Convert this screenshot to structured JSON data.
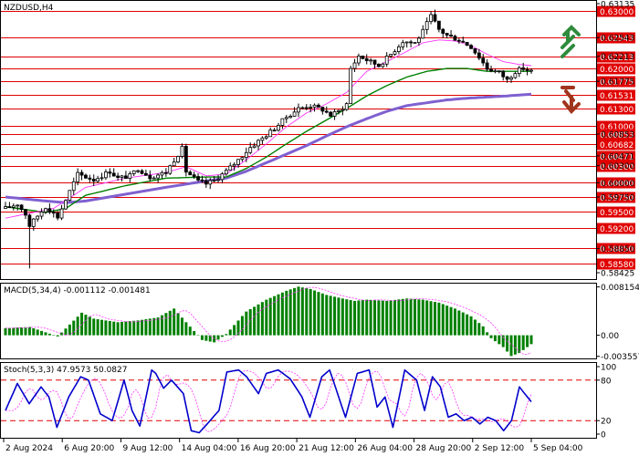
{
  "chart_data": [
    {
      "type": "candlestick",
      "title": "NZDUSD,H4",
      "ylim": [
        0.58425,
        0.63135
      ],
      "y_ticks": [
        "0.63135",
        "0.62543",
        "0.62213",
        "0.61775",
        "0.60853",
        "0.60471",
        "0.60300",
        "0.60000",
        "0.59750",
        "0.58850",
        "0.58425"
      ],
      "level_lines": [
        "0.63000",
        "0.62543",
        "0.62213",
        "0.62000",
        "0.61775",
        "0.61531",
        "0.61300",
        "0.61000",
        "0.60853",
        "0.60682",
        "0.60471",
        "0.60300",
        "0.60000",
        "0.59750",
        "0.59500",
        "0.59200",
        "0.58850",
        "0.58580"
      ],
      "x_labels": [
        "2 Aug 2024",
        "6 Aug 20:00",
        "9 Aug 12:00",
        "14 Aug 04:00",
        "16 Aug 20:00",
        "21 Aug 12:00",
        "26 Aug 04:00",
        "28 Aug 20:00",
        "2 Sep 12:00",
        "5 Sep 04:00"
      ],
      "colors": {
        "level": "#e00000",
        "ma_fast": "#ff33ff",
        "ma_mid": "#008000",
        "ma_slow": "#8060d0",
        "arrow_up": "#2e8b3c",
        "arrow_down": "#a0341c"
      },
      "close_path": [
        [
          0,
          0.5955
        ],
        [
          3,
          0.5963
        ],
        [
          5,
          0.5945
        ],
        [
          6,
          0.5925
        ],
        [
          8,
          0.5942
        ],
        [
          10,
          0.5958
        ],
        [
          13,
          0.594
        ],
        [
          16,
          0.5985
        ],
        [
          18,
          0.6015
        ],
        [
          22,
          0.6005
        ],
        [
          26,
          0.602
        ],
        [
          28,
          0.6008
        ],
        [
          31,
          0.6012
        ],
        [
          33,
          0.6025
        ],
        [
          36,
          0.601
        ],
        [
          40,
          0.6018
        ],
        [
          42,
          0.604
        ],
        [
          44,
          0.606
        ],
        [
          45,
          0.602
        ],
        [
          48,
          0.6002
        ],
        [
          50,
          0.5998
        ],
        [
          52,
          0.6004
        ],
        [
          55,
          0.602
        ],
        [
          58,
          0.604
        ],
        [
          61,
          0.6062
        ],
        [
          64,
          0.6078
        ],
        [
          67,
          0.6095
        ],
        [
          70,
          0.6115
        ],
        [
          73,
          0.613
        ],
        [
          76,
          0.6135
        ],
        [
          79,
          0.6128
        ],
        [
          81,
          0.6118
        ],
        [
          83,
          0.6125
        ],
        [
          85,
          0.6138
        ],
        [
          86,
          0.62
        ],
        [
          88,
          0.6222
        ],
        [
          90,
          0.6215
        ],
        [
          93,
          0.6205
        ],
        [
          96,
          0.6225
        ],
        [
          99,
          0.6248
        ],
        [
          102,
          0.6245
        ],
        [
          104,
          0.6265
        ],
        [
          106,
          0.6292
        ],
        [
          108,
          0.6268
        ],
        [
          110,
          0.6258
        ],
        [
          113,
          0.625
        ],
        [
          116,
          0.6238
        ],
        [
          118,
          0.622
        ],
        [
          120,
          0.62
        ],
        [
          123,
          0.6193
        ],
        [
          125,
          0.618
        ],
        [
          127,
          0.6195
        ],
        [
          129,
          0.62
        ],
        [
          131,
          0.6195
        ]
      ],
      "ma_fast_path": [
        [
          0,
          0.5938
        ],
        [
          12,
          0.5955
        ],
        [
          20,
          0.5992
        ],
        [
          30,
          0.6008
        ],
        [
          40,
          0.6018
        ],
        [
          45,
          0.6028
        ],
        [
          50,
          0.6012
        ],
        [
          55,
          0.6015
        ],
        [
          60,
          0.604
        ],
        [
          65,
          0.6068
        ],
        [
          70,
          0.6098
        ],
        [
          75,
          0.6122
        ],
        [
          80,
          0.6138
        ],
        [
          85,
          0.6158
        ],
        [
          90,
          0.6195
        ],
        [
          95,
          0.6212
        ],
        [
          100,
          0.623
        ],
        [
          104,
          0.6245
        ],
        [
          108,
          0.625
        ],
        [
          112,
          0.6248
        ],
        [
          116,
          0.624
        ],
        [
          120,
          0.6225
        ],
        [
          124,
          0.6212
        ],
        [
          128,
          0.6207
        ],
        [
          131,
          0.6205
        ]
      ],
      "ma_mid_path": [
        [
          0,
          0.5958
        ],
        [
          10,
          0.5948
        ],
        [
          15,
          0.5955
        ],
        [
          20,
          0.5978
        ],
        [
          30,
          0.5995
        ],
        [
          40,
          0.6008
        ],
        [
          50,
          0.601
        ],
        [
          55,
          0.601
        ],
        [
          60,
          0.6025
        ],
        [
          65,
          0.6045
        ],
        [
          70,
          0.6068
        ],
        [
          75,
          0.609
        ],
        [
          80,
          0.611
        ],
        [
          85,
          0.613
        ],
        [
          90,
          0.6152
        ],
        [
          95,
          0.617
        ],
        [
          100,
          0.6185
        ],
        [
          105,
          0.6195
        ],
        [
          110,
          0.62
        ],
        [
          115,
          0.62
        ],
        [
          120,
          0.6195
        ],
        [
          125,
          0.6195
        ],
        [
          131,
          0.6195
        ]
      ],
      "ma_slow_path": [
        [
          0,
          0.5975
        ],
        [
          10,
          0.5968
        ],
        [
          15,
          0.5965
        ],
        [
          20,
          0.5968
        ],
        [
          30,
          0.598
        ],
        [
          40,
          0.5992
        ],
        [
          50,
          0.6003
        ],
        [
          55,
          0.6008
        ],
        [
          60,
          0.602
        ],
        [
          65,
          0.6035
        ],
        [
          70,
          0.605
        ],
        [
          75,
          0.6065
        ],
        [
          80,
          0.6082
        ],
        [
          85,
          0.6098
        ],
        [
          90,
          0.6112
        ],
        [
          95,
          0.6125
        ],
        [
          100,
          0.6135
        ],
        [
          105,
          0.614
        ],
        [
          110,
          0.6145
        ],
        [
          115,
          0.6148
        ],
        [
          120,
          0.615
        ],
        [
          125,
          0.6152
        ],
        [
          131,
          0.6155
        ]
      ],
      "n_bars": 132
    },
    {
      "type": "histogram",
      "title": "MACD(5,34,4) -0.001112 -0.001481",
      "ylim": [
        -0.0036,
        0.0084
      ],
      "y_ticks": [
        "0.008154",
        "0.00",
        "-0.003557"
      ],
      "colors": {
        "bars": "#008000",
        "signal": "#ff33ff"
      },
      "bar_profile": [
        [
          0,
          0.0012
        ],
        [
          6,
          0.0014
        ],
        [
          10,
          0.0005
        ],
        [
          13,
          -0.0002
        ],
        [
          16,
          0.0018
        ],
        [
          19,
          0.0038
        ],
        [
          22,
          0.0028
        ],
        [
          28,
          0.0022
        ],
        [
          33,
          0.0025
        ],
        [
          38,
          0.003
        ],
        [
          42,
          0.0045
        ],
        [
          45,
          0.0022
        ],
        [
          49,
          -0.0008
        ],
        [
          52,
          -0.0012
        ],
        [
          55,
          0.0002
        ],
        [
          60,
          0.004
        ],
        [
          65,
          0.006
        ],
        [
          70,
          0.0075
        ],
        [
          73,
          0.0082
        ],
        [
          76,
          0.0078
        ],
        [
          80,
          0.0068
        ],
        [
          84,
          0.0062
        ],
        [
          87,
          0.0058
        ],
        [
          90,
          0.006
        ],
        [
          95,
          0.0058
        ],
        [
          100,
          0.0062
        ],
        [
          104,
          0.006
        ],
        [
          108,
          0.0055
        ],
        [
          112,
          0.0045
        ],
        [
          116,
          0.0032
        ],
        [
          119,
          0.0015
        ],
        [
          121,
          -0.0005
        ],
        [
          124,
          -0.002
        ],
        [
          126,
          -0.0035
        ],
        [
          128,
          -0.003
        ],
        [
          131,
          -0.0015
        ]
      ],
      "signal_lag": 2
    },
    {
      "type": "line",
      "title": "Stoch(5,3,3) 47.9573 50.0827",
      "ylim": [
        0,
        100
      ],
      "y_ticks": [
        "100",
        "80",
        "20",
        "0"
      ],
      "levels": [
        80,
        20
      ],
      "colors": {
        "main": "#0000cc",
        "signal": "#ff33ff",
        "levels": "#e00000"
      },
      "main_path": [
        [
          0,
          35
        ],
        [
          3,
          75
        ],
        [
          6,
          45
        ],
        [
          9,
          70
        ],
        [
          11,
          55
        ],
        [
          13,
          10
        ],
        [
          16,
          55
        ],
        [
          19,
          85
        ],
        [
          21,
          80
        ],
        [
          24,
          30
        ],
        [
          27,
          20
        ],
        [
          30,
          80
        ],
        [
          32,
          35
        ],
        [
          34,
          12
        ],
        [
          37,
          95
        ],
        [
          38,
          90
        ],
        [
          40,
          68
        ],
        [
          42,
          80
        ],
        [
          45,
          60
        ],
        [
          47,
          5
        ],
        [
          49,
          2
        ],
        [
          51,
          15
        ],
        [
          54,
          35
        ],
        [
          56,
          92
        ],
        [
          59,
          95
        ],
        [
          61,
          85
        ],
        [
          64,
          60
        ],
        [
          66,
          90
        ],
        [
          69,
          95
        ],
        [
          72,
          82
        ],
        [
          75,
          55
        ],
        [
          77,
          25
        ],
        [
          80,
          85
        ],
        [
          82,
          95
        ],
        [
          84,
          60
        ],
        [
          86,
          25
        ],
        [
          89,
          90
        ],
        [
          92,
          95
        ],
        [
          94,
          40
        ],
        [
          96,
          55
        ],
        [
          98,
          10
        ],
        [
          101,
          95
        ],
        [
          104,
          80
        ],
        [
          106,
          35
        ],
        [
          108,
          85
        ],
        [
          110,
          70
        ],
        [
          112,
          25
        ],
        [
          114,
          30
        ],
        [
          116,
          20
        ],
        [
          118,
          25
        ],
        [
          120,
          15
        ],
        [
          122,
          25
        ],
        [
          124,
          20
        ],
        [
          126,
          5
        ],
        [
          128,
          20
        ],
        [
          130,
          70
        ],
        [
          132,
          55
        ],
        [
          133,
          48
        ]
      ],
      "signal_lag": 2
    }
  ]
}
